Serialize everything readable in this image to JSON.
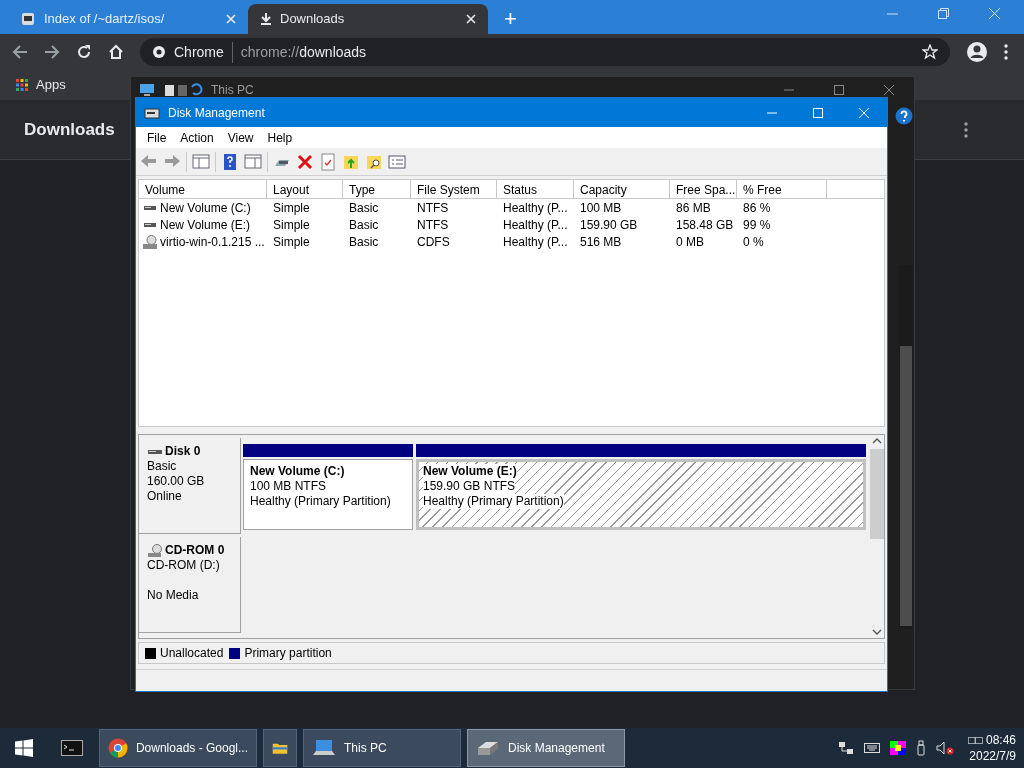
{
  "browser": {
    "tabs": [
      {
        "title": "Index of /~dartz/isos/",
        "selected": false,
        "kind": "page"
      },
      {
        "title": "Downloads",
        "selected": true,
        "kind": "download"
      }
    ],
    "new_tab": "+",
    "address": {
      "chip": "Chrome",
      "scheme": "chrome://",
      "path": "downloads"
    },
    "bookmarks": [
      "Apps"
    ],
    "page_title": "Downloads"
  },
  "background_window": {
    "title": "This PC"
  },
  "disk_management": {
    "title": "Disk Management",
    "menu": [
      "File",
      "Action",
      "View",
      "Help"
    ],
    "columns": [
      "Volume",
      "Layout",
      "Type",
      "File System",
      "Status",
      "Capacity",
      "Free Spa...",
      "% Free"
    ],
    "rows": [
      {
        "kind": "disk",
        "cells": [
          "New Volume (C:)",
          "Simple",
          "Basic",
          "NTFS",
          "Healthy (P...",
          "100 MB",
          "86 MB",
          "86 %"
        ]
      },
      {
        "kind": "disk",
        "cells": [
          "New Volume (E:)",
          "Simple",
          "Basic",
          "NTFS",
          "Healthy (P...",
          "159.90 GB",
          "158.48 GB",
          "99 %"
        ]
      },
      {
        "kind": "cd",
        "cells": [
          "virtio-win-0.1.215 ...",
          "Simple",
          "Basic",
          "CDFS",
          "Healthy (P...",
          "516 MB",
          "0 MB",
          "0 %"
        ]
      }
    ],
    "disks": [
      {
        "kind": "disk",
        "name": "Disk 0",
        "type": "Basic",
        "size": "160.00 GB",
        "status": "Online",
        "partitions": [
          {
            "name": "New Volume  (C:)",
            "size": "100 MB NTFS",
            "status": "Healthy (Primary Partition)",
            "selected": false
          },
          {
            "name": "New Volume  (E:)",
            "size": "159.90 GB NTFS",
            "status": "Healthy (Primary Partition)",
            "selected": true
          }
        ]
      },
      {
        "kind": "cd",
        "name": "CD-ROM 0",
        "type": "CD-ROM (D:)",
        "status": "No Media"
      }
    ],
    "legend": [
      {
        "label": "Unallocated",
        "color": "#000000"
      },
      {
        "label": "Primary partition",
        "color": "#000080"
      }
    ]
  },
  "taskbar": {
    "items": [
      {
        "kind": "chrome",
        "label": "Downloads - Googl...",
        "selected": false
      },
      {
        "kind": "folder",
        "selected": false
      },
      {
        "kind": "computer",
        "label": "This PC",
        "selected": false
      },
      {
        "kind": "disk",
        "label": "Disk Management",
        "selected": true
      }
    ],
    "time": "□□ 08:46",
    "date": "2022/7/9"
  }
}
